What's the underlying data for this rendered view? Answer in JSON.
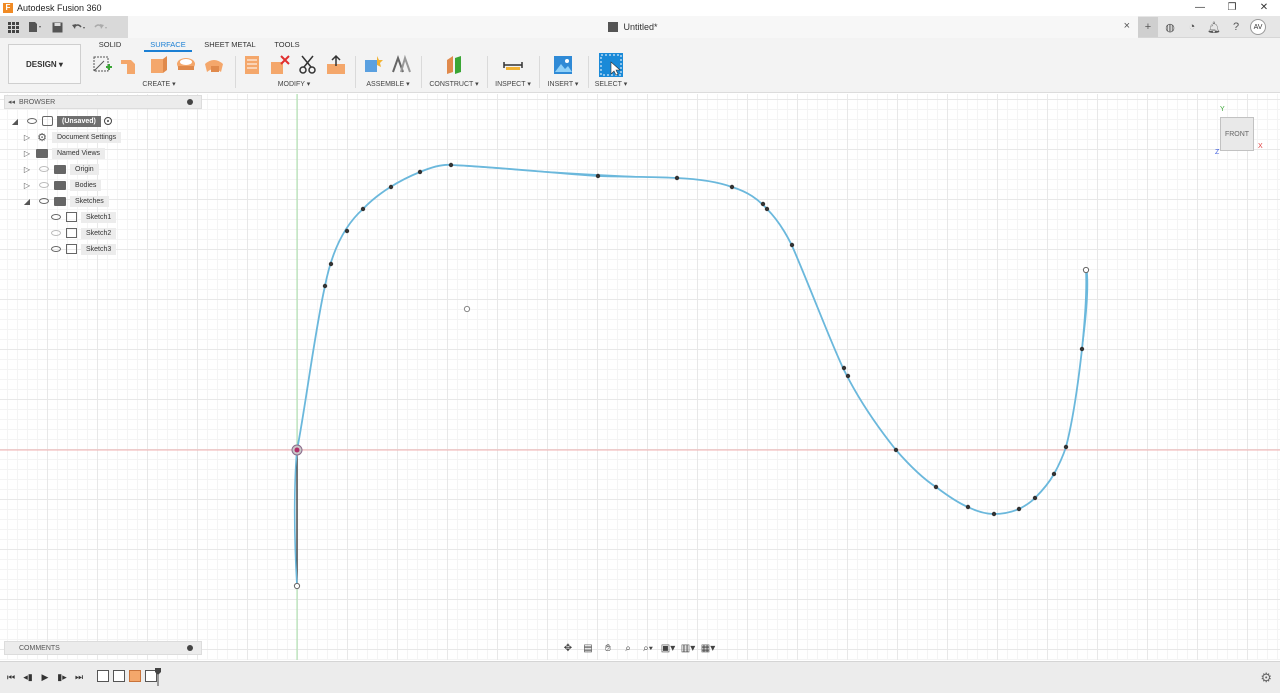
{
  "window": {
    "app_title": "Autodesk Fusion 360",
    "logo_letter": "F",
    "minimize": "—",
    "maximize": "❐",
    "close": "✕"
  },
  "qat": {
    "grid_icon": "apps-grid-icon",
    "file_icon": "file-icon",
    "save_icon": "save-icon",
    "undo_icon": "undo-icon",
    "redo_icon": "redo-icon"
  },
  "document": {
    "title": "Untitled*",
    "close": "×"
  },
  "account": {
    "initials": "AV"
  },
  "workspace": {
    "label": "DESIGN ▾"
  },
  "tabs": [
    {
      "label": "SOLID",
      "active": false
    },
    {
      "label": "SURFACE",
      "active": true
    },
    {
      "label": "SHEET METAL",
      "active": false
    },
    {
      "label": "TOOLS",
      "active": false
    }
  ],
  "groups": {
    "create": "CREATE ▾",
    "modify": "MODIFY ▾",
    "assemble": "ASSEMBLE ▾",
    "construct": "CONSTRUCT ▾",
    "inspect": "INSPECT ▾",
    "insert": "INSERT ▾",
    "select": "SELECT ▾"
  },
  "browser": {
    "title": "BROWSER",
    "collapse": "◂◂",
    "root": "(Unsaved)",
    "items": [
      {
        "label": "Document Settings",
        "expanded": false
      },
      {
        "label": "Named Views",
        "expanded": false
      },
      {
        "label": "Origin",
        "expanded": false
      },
      {
        "label": "Bodies",
        "expanded": false
      },
      {
        "label": "Sketches",
        "expanded": true
      }
    ],
    "sketches": [
      "Sketch1",
      "Sketch2",
      "Sketch3"
    ]
  },
  "viewcube": {
    "face": "FRONT",
    "axis_x": "X",
    "axis_y": "Y",
    "axis_z": "Z"
  },
  "comments": {
    "title": "COMMENTS"
  },
  "colors": {
    "accent": "#1a7fd4",
    "spline": "#6bb8dc",
    "surface_icon": "#f4a76b",
    "grid": "#e8e8e8"
  }
}
